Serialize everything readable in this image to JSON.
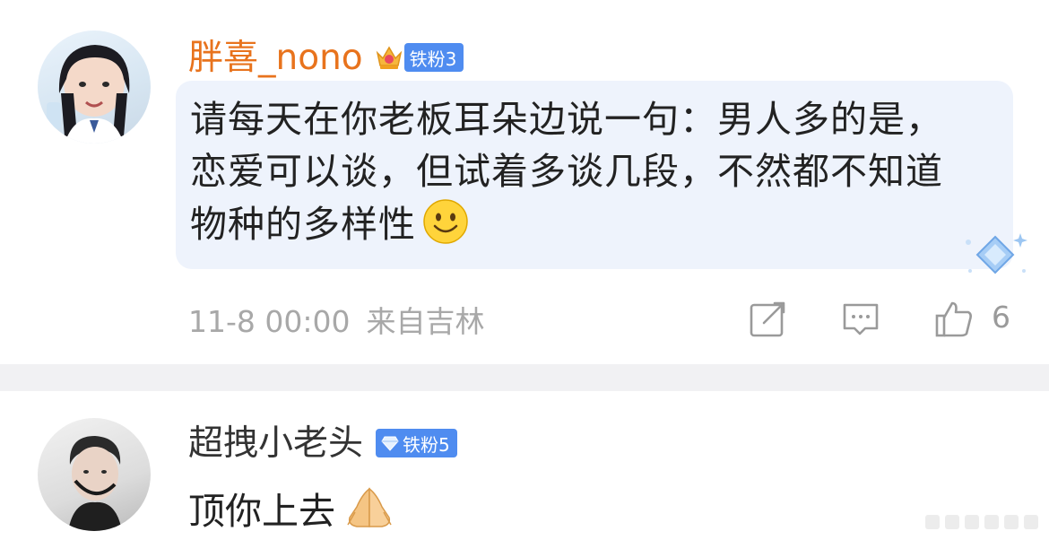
{
  "comments": [
    {
      "username": "胖喜_nono",
      "fan_badge": "铁粉3",
      "text": "请每天在你老板耳朵边说一句：男人多的是，恋爱可以谈，但试着多谈几段，不然都不知道物种的多样性",
      "emoji": "smile-emoji",
      "timestamp": "11-8 00:00",
      "location": "来自吉林",
      "like_count": "6",
      "icons": [
        "crown-icon",
        "share-icon",
        "reply-icon",
        "like-icon",
        "diamond-sparkle-icon"
      ]
    },
    {
      "username": "超拽小老头",
      "fan_badge": "铁粉5",
      "text": "顶你上去",
      "emoji": "praying-hands-emoji",
      "icons": [
        "diamond-icon"
      ]
    }
  ],
  "colors": {
    "vip_name": "#e8731d",
    "normal_name": "#333333",
    "badge_blue": "#4f8cf0",
    "bubble": "#eef3fc",
    "meta": "#a8a8a8",
    "divider": "#f1f1f3"
  }
}
